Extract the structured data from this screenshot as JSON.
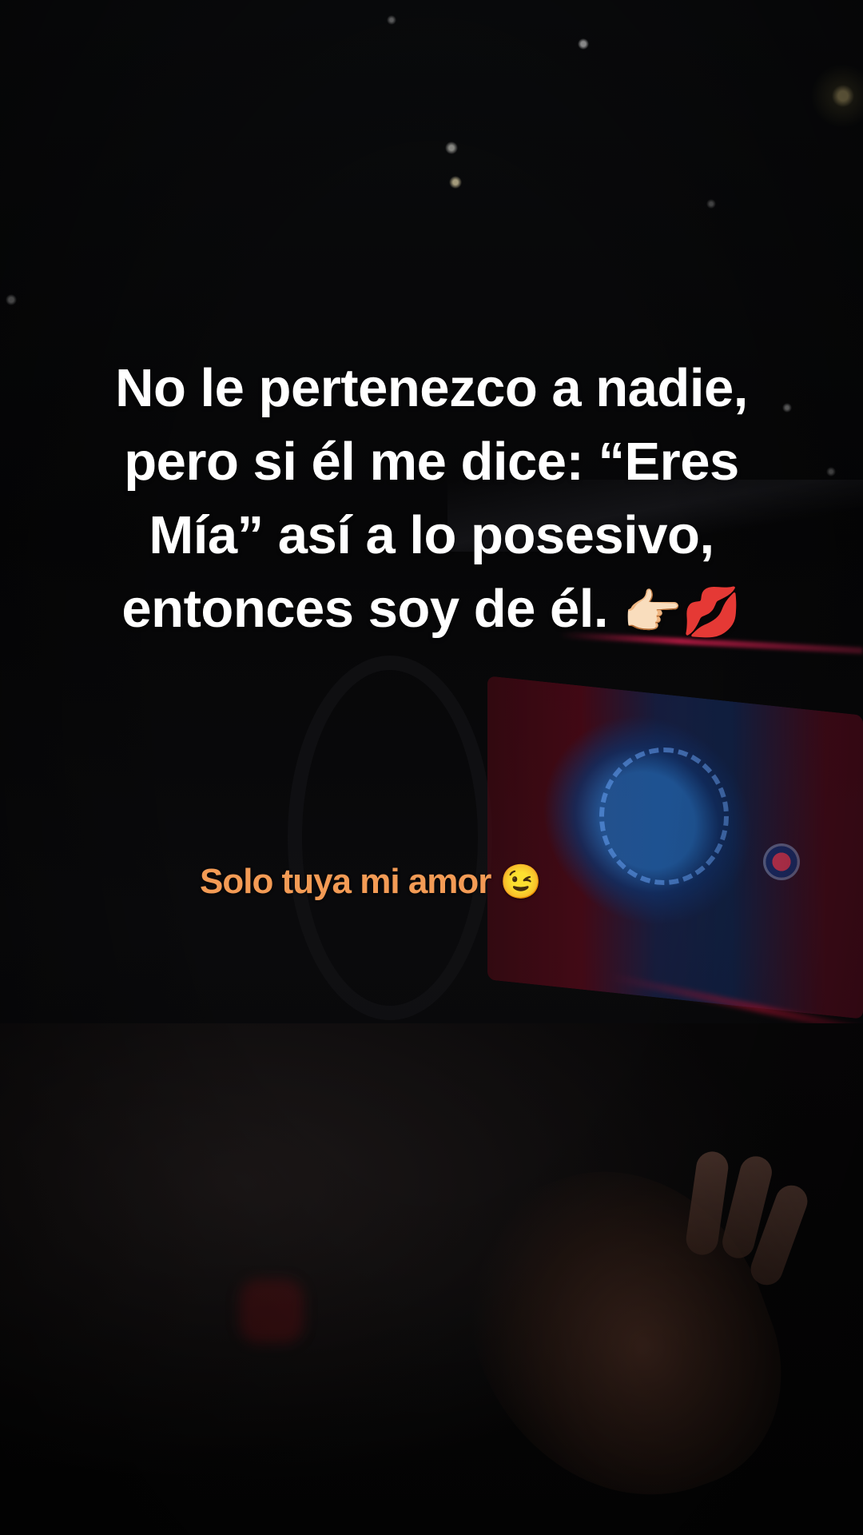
{
  "caption": {
    "line1": "No le pertenezco a nadie,",
    "line2": "pero si él me dice: “Eres",
    "line3": "Mía” así a lo posesivo,",
    "line4_text": "entonces soy de él.",
    "line4_emoji1": "👉🏻",
    "line4_emoji2": "💋"
  },
  "subcaption": {
    "text": "Solo tuya mi amor",
    "emoji": "😉"
  },
  "colors": {
    "caption": "#ffffff",
    "subcaption": "#f39b55",
    "background": "#050506"
  }
}
